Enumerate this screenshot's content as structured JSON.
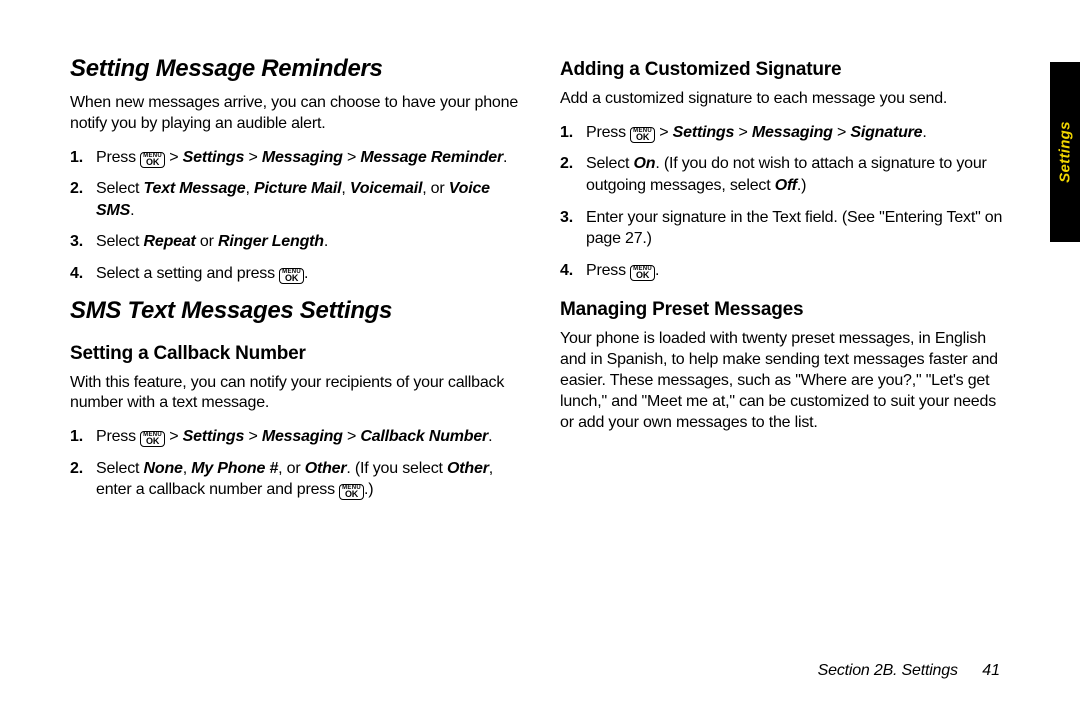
{
  "sideTab": {
    "label": "Settings"
  },
  "footer": {
    "section": "Section 2B. Settings",
    "page": "41"
  },
  "okButton": {
    "top": "MENU",
    "bottom": "OK"
  },
  "left": {
    "h1": "Setting Message Reminders",
    "p1": "When new messages arrive, you can choose to have your phone notify you by playing an audible alert.",
    "s1_press": "Press ",
    "s1_gt": " > ",
    "s1_settings": "Settings",
    "s1_messaging": "Messaging",
    "s1_msgrem": "Message Reminder",
    "s1_dot": ".",
    "s2_select": "Select ",
    "s2_tm": "Text Message",
    "s2_c1": ", ",
    "s2_pm": "Picture Mail",
    "s2_c2": ", ",
    "s2_vm": "Voicemail",
    "s2_or": ", or ",
    "s2_vsms": "Voice SMS",
    "s2_dot": ".",
    "s3_select": "Select ",
    "s3_repeat": "Repeat",
    "s3_or": " or ",
    "s3_rl": "Ringer Length",
    "s3_dot": ".",
    "s4_a": "Select a setting and press ",
    "s4_dot": ".",
    "h2": "SMS Text Messages Settings",
    "h3a": "Setting a Callback Number",
    "p2": "With this feature, you can notify your recipients of your callback number with a text message.",
    "c1_press": "Press ",
    "c1_gt": " > ",
    "c1_settings": "Settings",
    "c1_messaging": "Messaging",
    "c1_cb": "Callback Number",
    "c1_dot": ".",
    "c2_select": "Select ",
    "c2_none": "None",
    "c2_c1": ", ",
    "c2_mp": "My Phone #",
    "c2_or": ", or ",
    "c2_other": "Other",
    "c2_if": ". (If you select ",
    "c2_other2": "Other",
    "c2_enter": ", enter a callback number and press ",
    "c2_close": ".)"
  },
  "right": {
    "h3a": "Adding a Customized Signature",
    "p1": "Add a customized signature to each message you send.",
    "s1_press": "Press ",
    "s1_gt": " > ",
    "s1_settings": "Settings",
    "s1_messaging": "Messaging",
    "s1_sig": "Signature",
    "s1_dot": ".",
    "s2_select": "Select ",
    "s2_on": "On",
    "s2_mid": ". (If you do not wish to attach a signature to your outgoing messages, select ",
    "s2_off": "Off",
    "s2_close": ".)",
    "s3": "Enter your signature in the Text field. (See \"Entering Text\" on page 27.)",
    "s4_press": "Press ",
    "s4_dot": ".",
    "h3b": "Managing Preset Messages",
    "p2": "Your phone is loaded with twenty preset messages, in English and in Spanish, to help make sending text messages faster and easier. These messages, such as \"Where are you?,\" \"Let's get lunch,\" and \"Meet me at,\" can be customized to suit your needs or add your own messages to the list."
  }
}
